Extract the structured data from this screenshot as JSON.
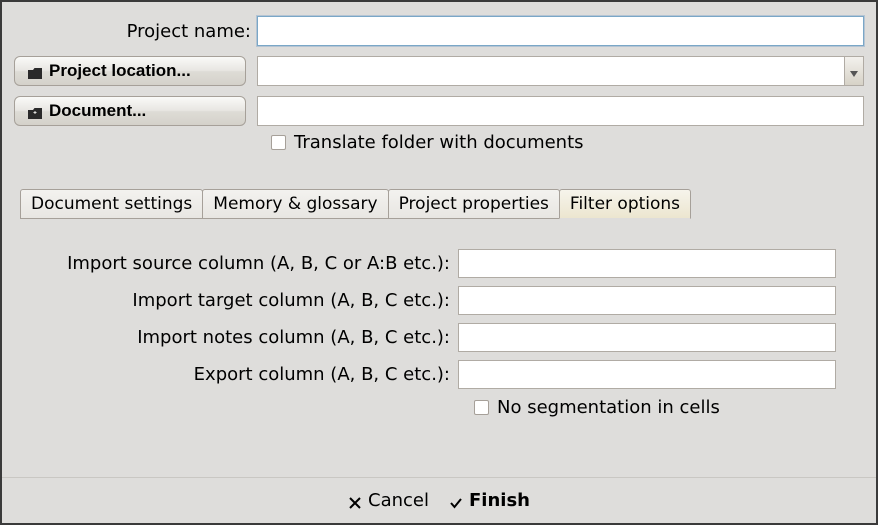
{
  "labels": {
    "project_name": "Project name:",
    "project_location_btn": "Project location...",
    "document_btn": "Document...",
    "translate_folder": "Translate folder with documents"
  },
  "values": {
    "project_name": "",
    "project_location": "",
    "document": ""
  },
  "checkboxes": {
    "translate_folder": false,
    "no_segmentation": false
  },
  "tabs": [
    {
      "id": "doc-settings",
      "label": "Document settings",
      "active": false
    },
    {
      "id": "memory-glossary",
      "label": "Memory & glossary",
      "active": false
    },
    {
      "id": "project-properties",
      "label": "Project properties",
      "active": false
    },
    {
      "id": "filter-options",
      "label": "Filter options",
      "active": true
    }
  ],
  "filter": {
    "rows": [
      {
        "id": "import-source",
        "label": "Import source column (A, B, C or A:B etc.):",
        "value": ""
      },
      {
        "id": "import-target",
        "label": "Import target column (A, B, C etc.):",
        "value": ""
      },
      {
        "id": "import-notes",
        "label": "Import notes column (A, B, C etc.):",
        "value": ""
      },
      {
        "id": "export-col",
        "label": "Export column (A, B, C etc.):",
        "value": ""
      }
    ],
    "no_segmentation_label": "No segmentation in cells"
  },
  "footer": {
    "cancel": "Cancel",
    "finish": "Finish"
  }
}
